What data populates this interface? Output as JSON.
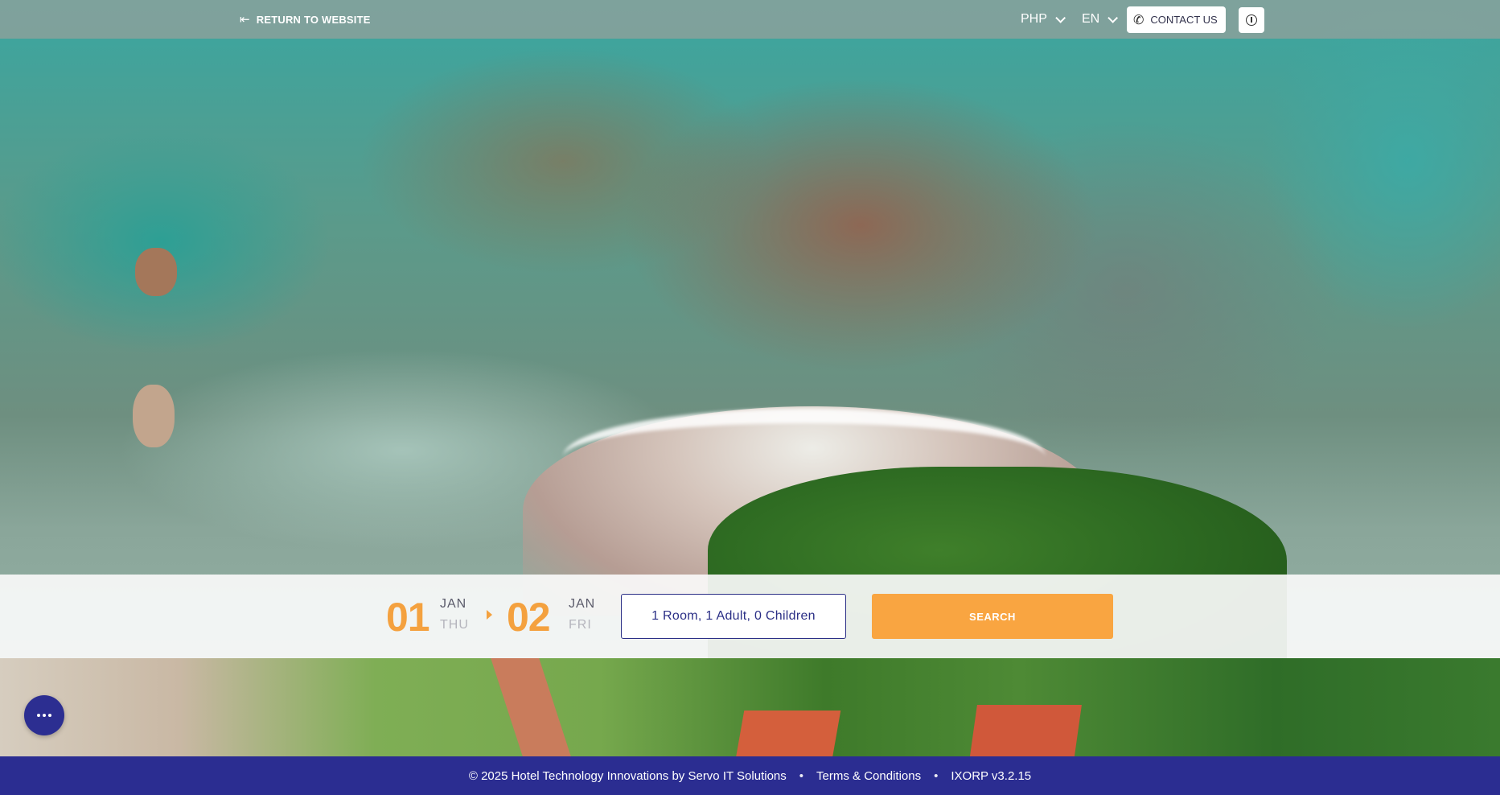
{
  "topbar": {
    "return_label": "RETURN TO WEBSITE",
    "return_icon": "arrow-left-to-bar-icon",
    "currency": "PHP",
    "language": "EN",
    "contact_label": "CONTACT US",
    "contact_icon": "phone-icon",
    "accessibility_icon": "accessibility-icon"
  },
  "search": {
    "checkin": {
      "day": "01",
      "month": "JAN",
      "weekday": "THU"
    },
    "checkout": {
      "day": "02",
      "month": "JAN",
      "weekday": "FRI"
    },
    "guests": "1 Room, 1 Adult, 0 Children",
    "search_label": "SEARCH"
  },
  "fab": {
    "icon": "more-dots-icon"
  },
  "footer": {
    "copyright": "© 2025 Hotel Technology Innovations by Servo IT Solutions",
    "separator": "•",
    "terms": "Terms & Conditions",
    "version": "IXORP v3.2.15"
  },
  "colors": {
    "accent_orange": "#f9a541",
    "brand_blue": "#2b2d91"
  }
}
